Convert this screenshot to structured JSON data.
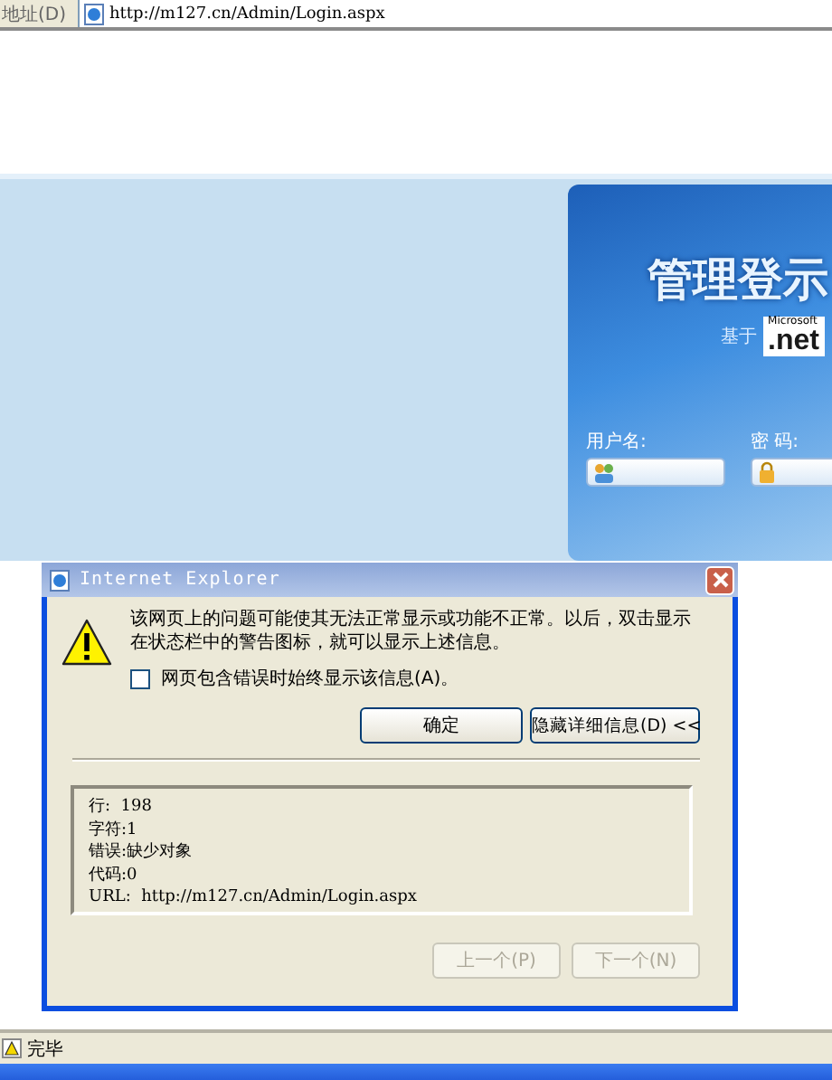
{
  "address_bar": {
    "label": "地址(D)",
    "url": "http://m127.cn/Admin/Login.aspx"
  },
  "login_panel": {
    "title": "管理登示",
    "based_on": "基于",
    "logo_small": "Microsoft",
    "logo": ".net",
    "username_label": "用户名:",
    "password_label": "密 码:"
  },
  "dialog": {
    "title": "Internet Explorer",
    "message": "该网页上的问题可能使其无法正常显示或功能不正常。以后，双击显示在状态栏中的警告图标，就可以显示上述信息。",
    "checkbox": {
      "label": "网页包含错误时始终显示该信息(A)。",
      "checked": false
    },
    "buttons": [
      {
        "label": "确定",
        "disabled": false
      },
      {
        "label": "隐藏详细信息(D) <<",
        "disabled": false
      }
    ],
    "details": [
      "行:  198",
      "字符:1",
      "错误:缺少对象",
      "代码:0",
      "URL:  http://m127.cn/Admin/Login.aspx"
    ],
    "nav_buttons": [
      {
        "label": "上一个(P)",
        "disabled": true
      },
      {
        "label": "下一个(N)",
        "disabled": true
      }
    ]
  },
  "status_bar": {
    "text": "完毕"
  }
}
